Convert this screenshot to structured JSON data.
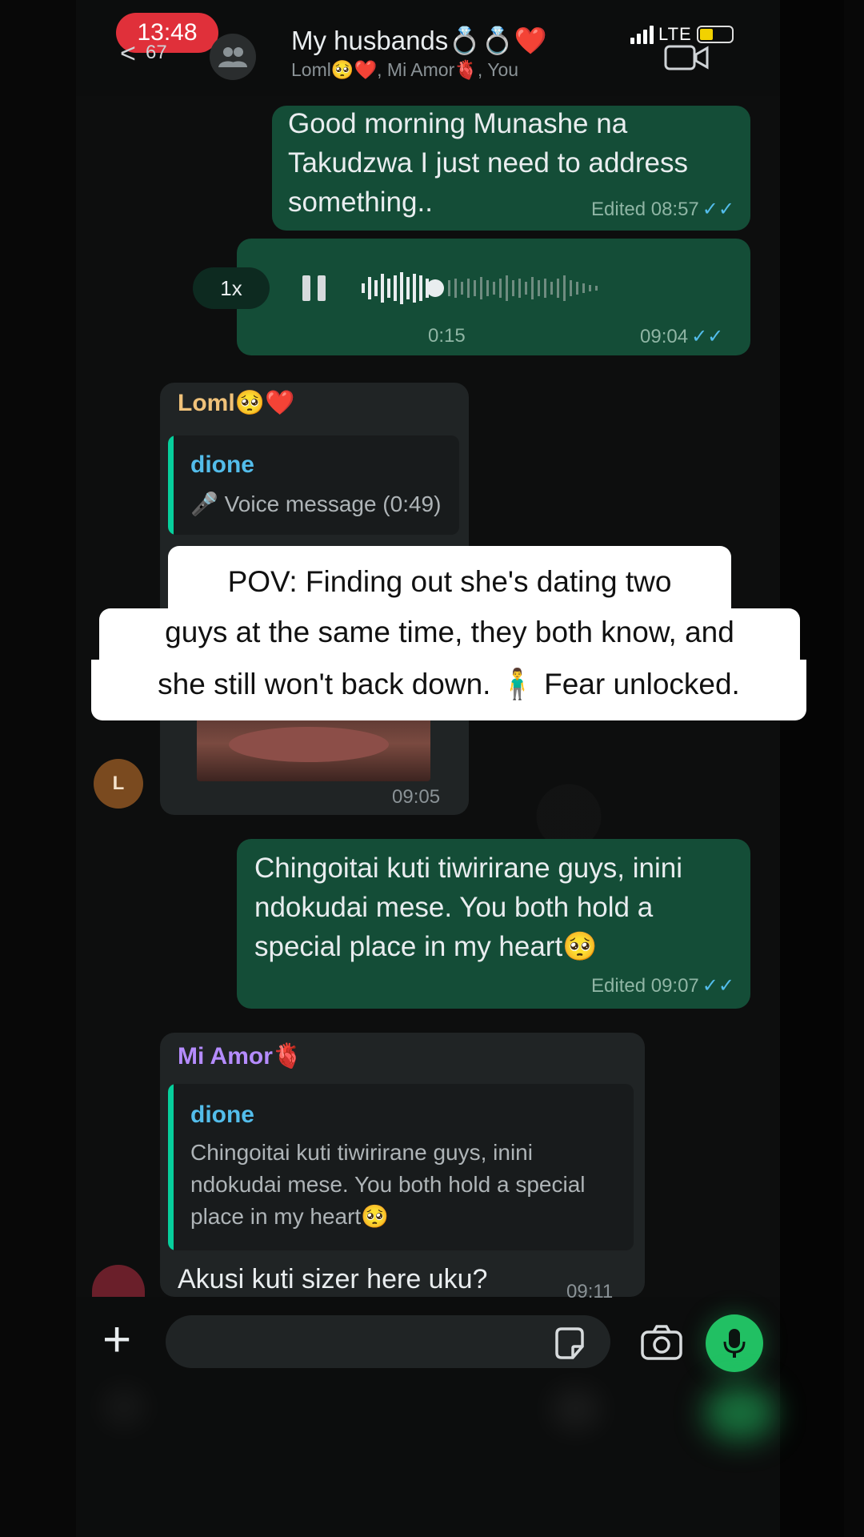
{
  "status_bar": {
    "time": "13:48",
    "network": "LTE"
  },
  "header": {
    "back_count": "67",
    "title": "My husbands💍💍❤️",
    "members": "Loml🥺❤️, Mi Amor🫀, You"
  },
  "messages": [
    {
      "type": "text",
      "direction": "out",
      "text_lines": [
        "Good morning Munashe na",
        "Takudzwa I just need to address",
        "something.."
      ],
      "meta": "Edited 08:57",
      "ticks": "✓✓"
    },
    {
      "type": "voice",
      "direction": "out",
      "speed": "1x",
      "duration": "0:15",
      "time": "09:04",
      "ticks": "✓✓"
    },
    {
      "type": "reply",
      "direction": "in",
      "sender": "Loml🥺❤️",
      "quote_name": "dione",
      "quote_text": "🎤 Voice message (0:49)",
      "avatar_letter": "L",
      "time": "09:05"
    },
    {
      "type": "text",
      "direction": "out",
      "text_lines": [
        "Chingoitai kuti tiwirirane guys, inini",
        "ndokudai mese. You both hold a",
        "special place in my heart🥺"
      ],
      "meta": "Edited 09:07",
      "ticks": "✓✓"
    },
    {
      "type": "reply",
      "direction": "in",
      "sender": "Mi Amor🫀",
      "quote_name": "dione",
      "quote_text_lines": [
        "Chingoitai kuti tiwirirane guys, inini",
        "ndokudai mese. You both hold a special",
        "place in my heart🥺"
      ],
      "text": "Akusi kuti sizer here uku?",
      "time": "09:11"
    }
  ],
  "caption": {
    "line1": "POV: Finding out she's dating two",
    "line2": "guys at the same time, they both know, and",
    "line3": "she still won't back down. 🧍‍♂️ Fear unlocked."
  },
  "colors": {
    "outgoing_bubble": "#144d37",
    "incoming_bubble": "#202425",
    "accent_green": "#21c063",
    "read_ticks": "#53bdeb",
    "loml_name": "#f0c27a",
    "amor_name": "#b58cff"
  },
  "icons": [
    "back-icon",
    "group-avatar-icon",
    "video-call-icon",
    "pause-icon",
    "waveform-icon",
    "microphone-icon",
    "plus-icon",
    "sticker-icon",
    "camera-icon"
  ]
}
